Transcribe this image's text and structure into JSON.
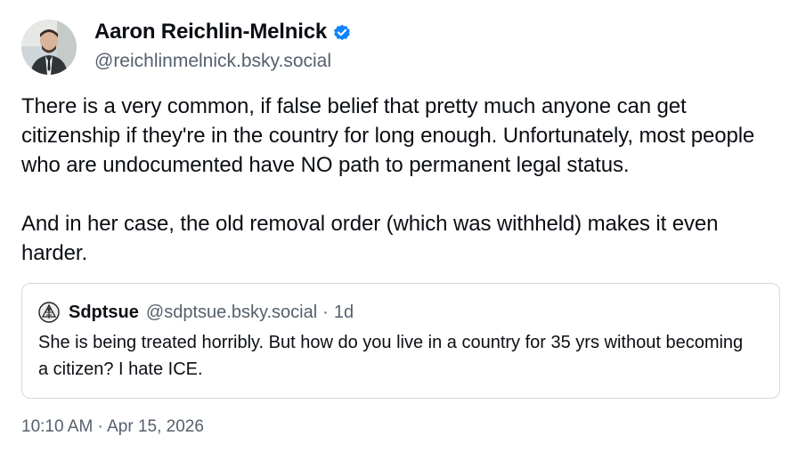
{
  "author": {
    "name": "Aaron Reichlin-Melnick",
    "handle": "@reichlinmelnick.bsky.social",
    "verified": true,
    "verified_color": "#1083fe"
  },
  "post": {
    "paragraphs": [
      "There is a very common, if false belief that pretty much anyone can get citizenship if they're in the country for long enough. Unfortunately, most people who are undocumented have NO path to permanent legal status.",
      "And in her case, the old removal order (which was withheld) makes it even harder."
    ]
  },
  "quote": {
    "name": "Sdptsue",
    "handle": "@sdptsue.bsky.social",
    "separator": "·",
    "time": "1d",
    "text": "She is being treated horribly. But how do you live in a country for 35 yrs without becoming a citizen? I hate ICE."
  },
  "timestamp": "10:10 AM · Apr 15, 2026"
}
